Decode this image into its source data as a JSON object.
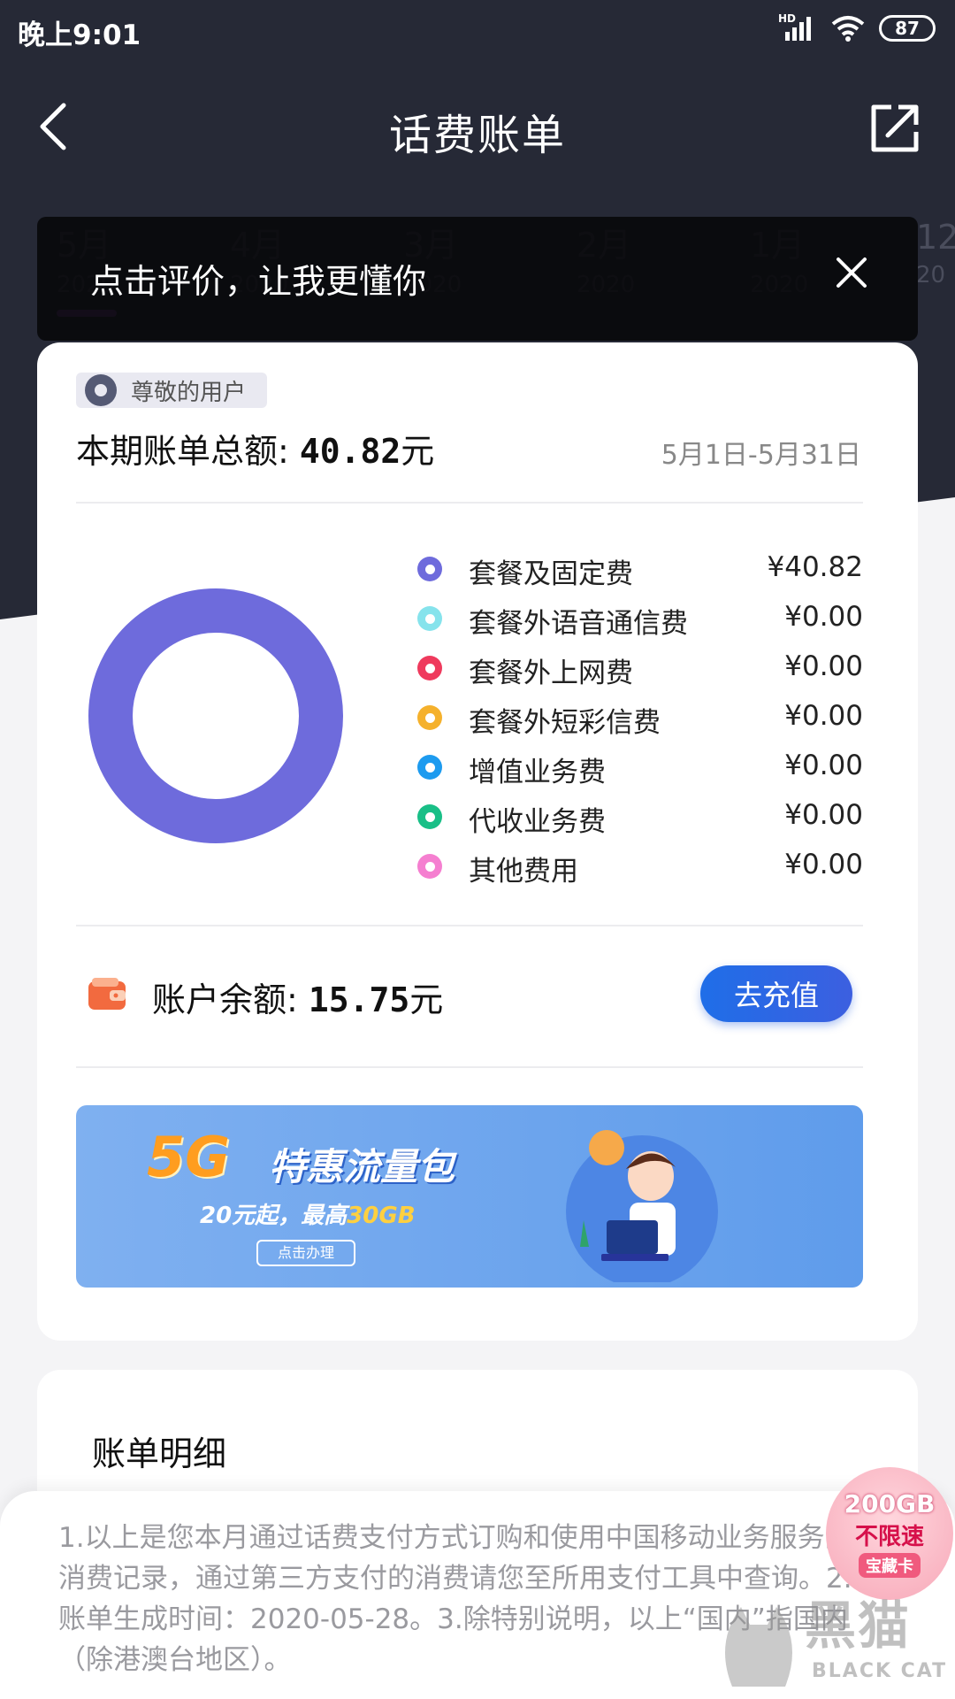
{
  "status_bar": {
    "time": "晚上9:01",
    "network": "HD",
    "battery": "87"
  },
  "header": {
    "title": "话费账单"
  },
  "month_tabs": [
    {
      "month": "5月",
      "year": "2020"
    },
    {
      "month": "4月",
      "year": "2020"
    },
    {
      "month": "3月",
      "year": "2020"
    },
    {
      "month": "2月",
      "year": "2020"
    },
    {
      "month": "1月",
      "year": "2020"
    },
    {
      "month": "12",
      "year": "20"
    }
  ],
  "toast": {
    "text": "点击评价，让我更懂你"
  },
  "bill": {
    "user_label": "尊敬的用户",
    "total_label": "本期账单总额: ",
    "total_amount": "40.82",
    "total_unit": "元",
    "period": "5月1日-5月31日",
    "breakdown": [
      {
        "name": "套餐及固定费",
        "value": "¥40.82",
        "amount": 40.82,
        "color": "#6e6bdc"
      },
      {
        "name": "套餐外语音通信费",
        "value": "¥0.00",
        "amount": 0,
        "color": "#86e3ec"
      },
      {
        "name": "套餐外上网费",
        "value": "¥0.00",
        "amount": 0,
        "color": "#ef3a5d"
      },
      {
        "name": "套餐外短彩信费",
        "value": "¥0.00",
        "amount": 0,
        "color": "#f5b12c"
      },
      {
        "name": "增值业务费",
        "value": "¥0.00",
        "amount": 0,
        "color": "#1d9bef"
      },
      {
        "name": "代收业务费",
        "value": "¥0.00",
        "amount": 0,
        "color": "#19bf87"
      },
      {
        "name": "其他费用",
        "value": "¥0.00",
        "amount": 0,
        "color": "#f57fd0"
      }
    ],
    "balance_label": "账户余额: ",
    "balance_amount": "15.75",
    "balance_unit": "元",
    "recharge_label": "去充值"
  },
  "banner": {
    "highlight": "5G",
    "title": "特惠流量包",
    "sub_prefix": "20元起，最高",
    "sub_highlight": "30GB",
    "button": "点击办理"
  },
  "detail": {
    "title": "账单明细"
  },
  "note": "1.以上是您本月通过话费支付方式订购和使用中国移动业务服务的消费记录，通过第三方支付的消费请您至所用支付工具中查询。2.账单生成时间：2020-05-28。3.除特别说明，以上“国内”指国内（除港澳台地区）。",
  "promo": {
    "line1": "200GB",
    "line2": "不限速",
    "line3": "宝藏卡"
  },
  "watermark": {
    "cn": "黑猫",
    "en": "BLACK CAT"
  }
}
